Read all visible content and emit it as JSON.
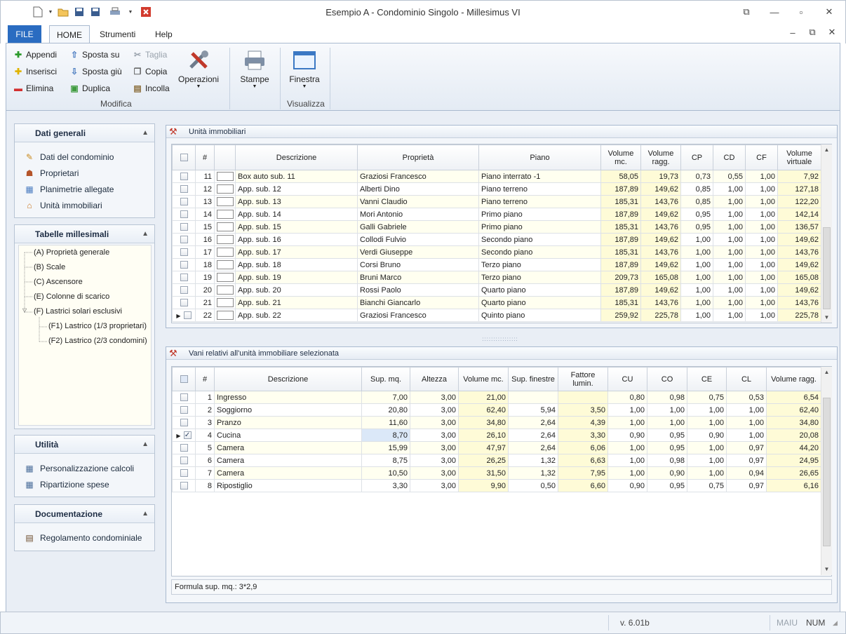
{
  "window": {
    "title": "Esempio A - Condominio Singolo - Millesimus VI"
  },
  "menu_tabs": [
    "FILE",
    "HOME",
    "Strumenti",
    "Help"
  ],
  "ribbon": {
    "edit": {
      "append": "Appendi",
      "insert": "Inserisci",
      "delete": "Elimina"
    },
    "move": {
      "up": "Sposta su",
      "down": "Sposta giù",
      "duplicate": "Duplica"
    },
    "clipboard": {
      "cut": "Taglia",
      "copy": "Copia",
      "paste": "Incolla"
    },
    "operations": "Operazioni",
    "group_modifica": "Modifica",
    "print": "Stampe",
    "window": "Finestra",
    "group_visualizza": "Visualizza"
  },
  "sidebar": {
    "general": {
      "title": "Dati generali",
      "items": [
        "Dati del condominio",
        "Proprietari",
        "Planimetrie allegate",
        "Unità immobiliari"
      ]
    },
    "tables": {
      "title": "Tabelle millesimali",
      "items": [
        "(A) Proprietà generale",
        "(B) Scale",
        "(C) Ascensore",
        "(E) Colonne di scarico",
        "(F) Lastrici solari esclusivi",
        "(F1) Lastrico (1/3 proprietari)",
        "(F2) Lastrico (2/3 condomini)"
      ]
    },
    "utility": {
      "title": "Utilità",
      "items": [
        "Personalizzazione calcoli",
        "Ripartizione spese"
      ]
    },
    "docs": {
      "title": "Documentazione",
      "items": [
        "Regolamento condominiale"
      ]
    }
  },
  "units": {
    "title": "Unità immobiliari",
    "headers": [
      "#",
      "Descrizione",
      "Proprietà",
      "Piano",
      "Volume mc.",
      "Volume ragg.",
      "CP",
      "CD",
      "CF",
      "Volume virtuale"
    ],
    "rows": [
      [
        "11",
        "Box auto sub. 11",
        "Graziosi Francesco",
        "Piano interrato -1",
        "58,05",
        "19,73",
        "0,73",
        "0,55",
        "1,00",
        "7,92"
      ],
      [
        "12",
        "App. sub. 12",
        "Alberti Dino",
        "Piano terreno",
        "187,89",
        "149,62",
        "0,85",
        "1,00",
        "1,00",
        "127,18"
      ],
      [
        "13",
        "App. sub. 13",
        "Vanni Claudio",
        "Piano terreno",
        "185,31",
        "143,76",
        "0,85",
        "1,00",
        "1,00",
        "122,20"
      ],
      [
        "14",
        "App. sub. 14",
        "Mori Antonio",
        "Primo piano",
        "187,89",
        "149,62",
        "0,95",
        "1,00",
        "1,00",
        "142,14"
      ],
      [
        "15",
        "App. sub. 15",
        "Galli Gabriele",
        "Primo piano",
        "185,31",
        "143,76",
        "0,95",
        "1,00",
        "1,00",
        "136,57"
      ],
      [
        "16",
        "App. sub. 16",
        "Collodi Fulvio",
        "Secondo piano",
        "187,89",
        "149,62",
        "1,00",
        "1,00",
        "1,00",
        "149,62"
      ],
      [
        "17",
        "App. sub. 17",
        "Verdi Giuseppe",
        "Secondo piano",
        "185,31",
        "143,76",
        "1,00",
        "1,00",
        "1,00",
        "143,76"
      ],
      [
        "18",
        "App. sub. 18",
        "Corsi Bruno",
        "Terzo piano",
        "187,89",
        "149,62",
        "1,00",
        "1,00",
        "1,00",
        "149,62"
      ],
      [
        "19",
        "App. sub. 19",
        "Bruni Marco",
        "Terzo piano",
        "209,73",
        "165,08",
        "1,00",
        "1,00",
        "1,00",
        "165,08"
      ],
      [
        "20",
        "App. sub. 20",
        "Rossi Paolo",
        "Quarto piano",
        "187,89",
        "149,62",
        "1,00",
        "1,00",
        "1,00",
        "149,62"
      ],
      [
        "21",
        "App. sub. 21",
        "Bianchi Giancarlo",
        "Quarto piano",
        "185,31",
        "143,76",
        "1,00",
        "1,00",
        "1,00",
        "143,76"
      ],
      [
        "22",
        "App. sub. 22",
        "Graziosi Francesco",
        "Quinto piano",
        "259,92",
        "225,78",
        "1,00",
        "1,00",
        "1,00",
        "225,78"
      ]
    ]
  },
  "rooms": {
    "title": "Vani relativi all'unità immobiliare selezionata",
    "headers": [
      "#",
      "Descrizione",
      "Sup. mq.",
      "Altezza",
      "Volume mc.",
      "Sup. finestre",
      "Fattore lumin.",
      "CU",
      "CO",
      "CE",
      "CL",
      "Volume ragg."
    ],
    "rows": [
      [
        "1",
        "Ingresso",
        "7,00",
        "3,00",
        "21,00",
        "",
        "",
        "0,80",
        "0,98",
        "0,75",
        "0,53",
        "6,54"
      ],
      [
        "2",
        "Soggiorno",
        "20,80",
        "3,00",
        "62,40",
        "5,94",
        "3,50",
        "1,00",
        "1,00",
        "1,00",
        "1,00",
        "62,40"
      ],
      [
        "3",
        "Pranzo",
        "11,60",
        "3,00",
        "34,80",
        "2,64",
        "4,39",
        "1,00",
        "1,00",
        "1,00",
        "1,00",
        "34,80"
      ],
      [
        "4",
        "Cucina",
        "8,70",
        "3,00",
        "26,10",
        "2,64",
        "3,30",
        "0,90",
        "0,95",
        "0,90",
        "1,00",
        "20,08"
      ],
      [
        "5",
        "Camera",
        "15,99",
        "3,00",
        "47,97",
        "2,64",
        "6,06",
        "1,00",
        "0,95",
        "1,00",
        "0,97",
        "44,20"
      ],
      [
        "6",
        "Camera",
        "8,75",
        "3,00",
        "26,25",
        "1,32",
        "6,63",
        "1,00",
        "0,98",
        "1,00",
        "0,97",
        "24,95"
      ],
      [
        "7",
        "Camera",
        "10,50",
        "3,00",
        "31,50",
        "1,32",
        "7,95",
        "1,00",
        "0,90",
        "1,00",
        "0,94",
        "26,65"
      ],
      [
        "8",
        "Ripostiglio",
        "3,30",
        "3,00",
        "9,90",
        "0,50",
        "6,60",
        "0,90",
        "0,95",
        "0,75",
        "0,97",
        "6,16"
      ]
    ],
    "checked_row": 3,
    "formula": "Formula sup. mq.: 3*2,9"
  },
  "status": {
    "version": "v. 6.01b",
    "caps": "MAIU",
    "num": "NUM"
  }
}
